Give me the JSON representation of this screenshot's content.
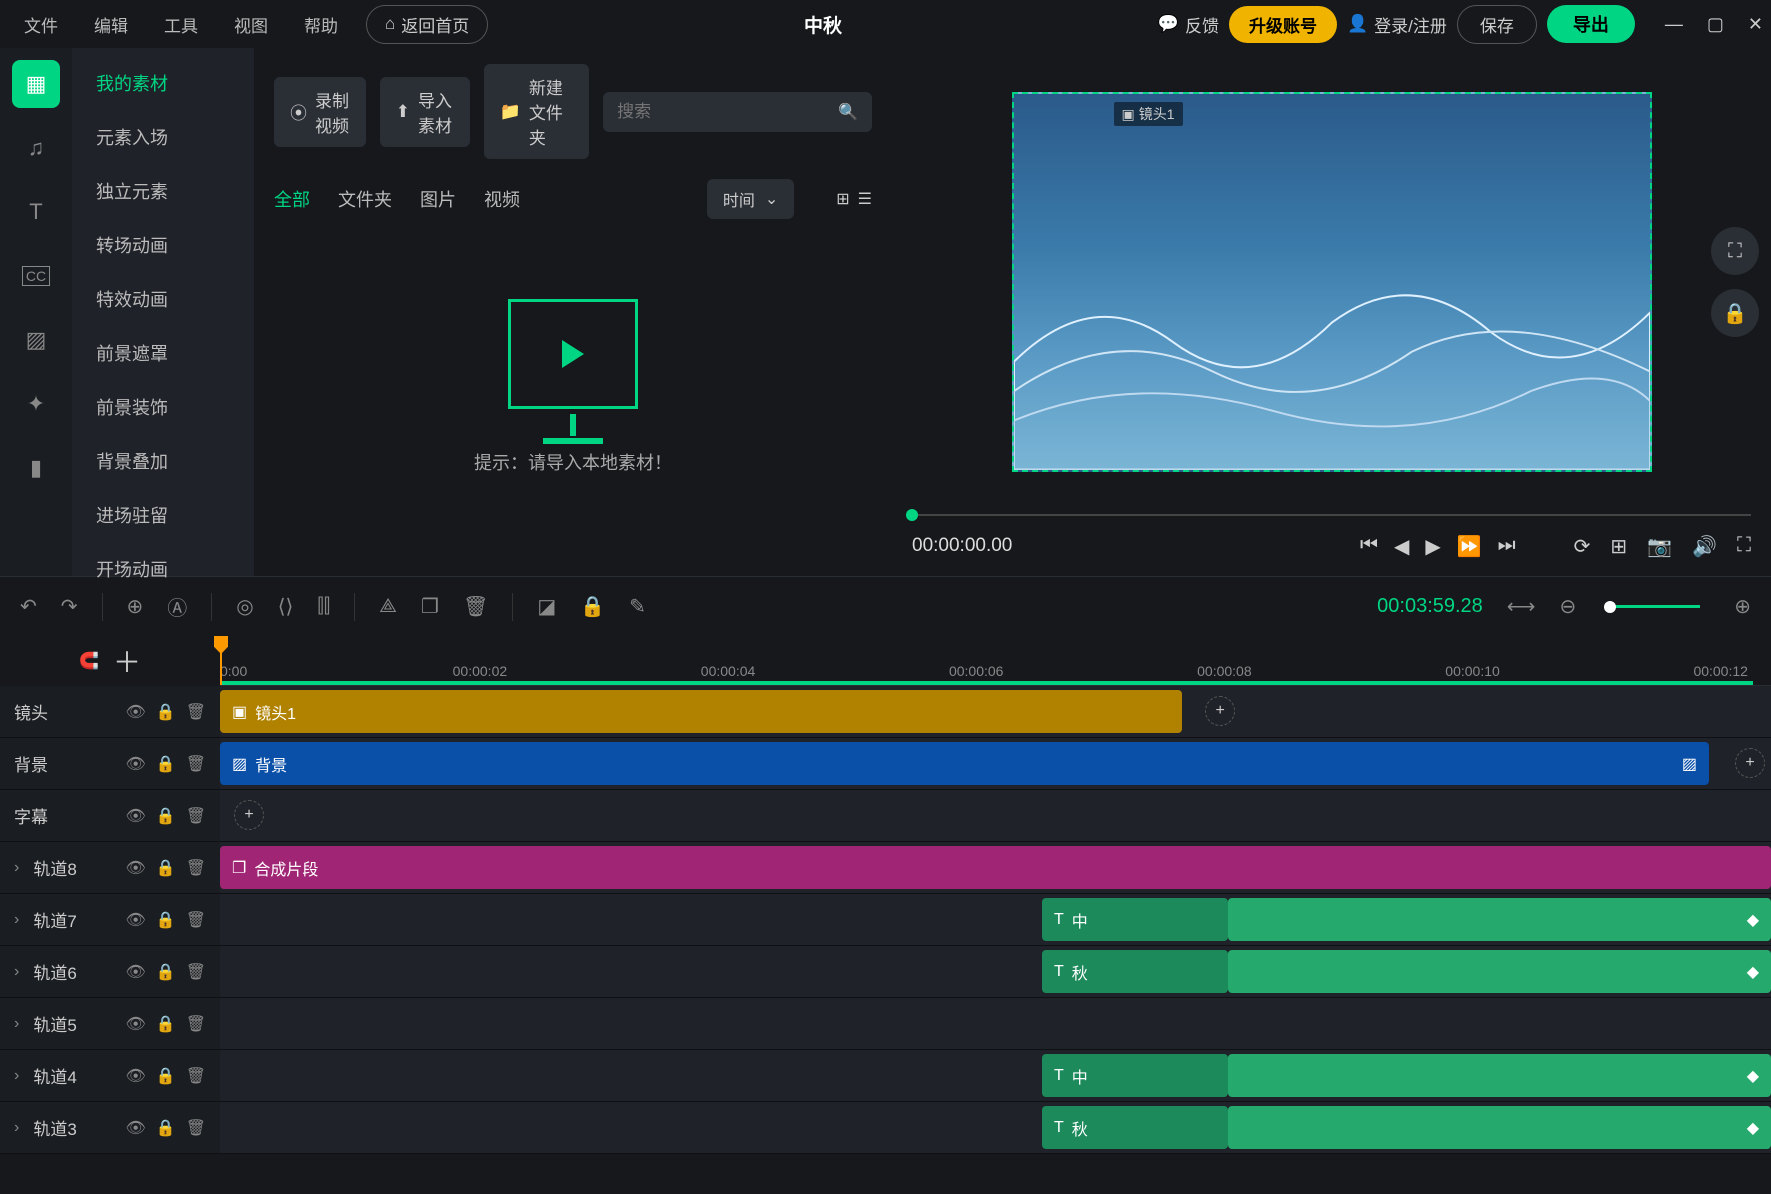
{
  "menu": [
    "文件",
    "编辑",
    "工具",
    "视图",
    "帮助"
  ],
  "home_btn": "返回首页",
  "project_name": "中秋",
  "feedback": "反馈",
  "upgrade": "升级账号",
  "login": "登录/注册",
  "save": "保存",
  "export": "导出",
  "categories": [
    "我的素材",
    "元素入场",
    "独立元素",
    "转场动画",
    "特效动画",
    "前景遮罩",
    "前景装饰",
    "背景叠加",
    "进场驻留",
    "开场动画"
  ],
  "toolbar": {
    "record": "录制视频",
    "import": "导入素材",
    "new_folder": "新建文件夹"
  },
  "search_placeholder": "搜索",
  "filters": [
    "全部",
    "文件夹",
    "图片",
    "视频"
  ],
  "sort": "时间",
  "empty_hint": "提示：请导入本地素材！",
  "preview": {
    "shot_label": "镜头1",
    "timestamp": "00:00:00.00"
  },
  "timeline_time": "00:03:59.28",
  "ruler": [
    "0:00",
    "00:00:02",
    "00:00:04",
    "00:00:06",
    "00:00:08",
    "00:00:10",
    "00:00:12"
  ],
  "tracks": {
    "shot": {
      "name": "镜头",
      "clip": "镜头1"
    },
    "bg": {
      "name": "背景",
      "clip": "背景"
    },
    "subtitle": {
      "name": "字幕"
    },
    "t8": {
      "name": "轨道8",
      "clip": "合成片段"
    },
    "t7": {
      "name": "轨道7",
      "clip": "中"
    },
    "t6": {
      "name": "轨道6",
      "clip": "秋"
    },
    "t5": {
      "name": "轨道5"
    },
    "t4": {
      "name": "轨道4",
      "clip": "中"
    },
    "t3": {
      "name": "轨道3",
      "clip": "秋"
    }
  }
}
